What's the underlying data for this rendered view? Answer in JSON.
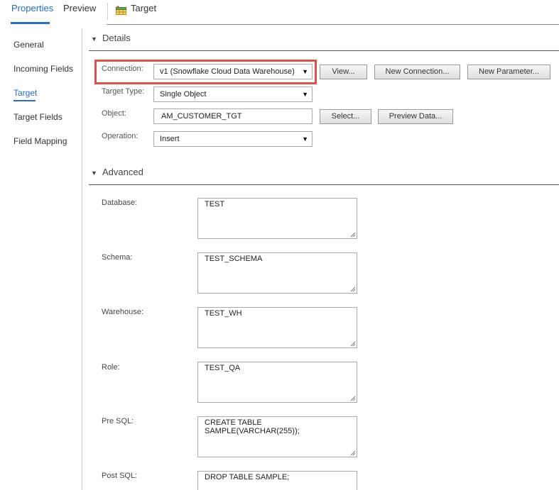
{
  "tabs": [
    {
      "label": "Properties",
      "active": true
    },
    {
      "label": "Preview",
      "active": false
    },
    {
      "label": "Target",
      "active": false,
      "icon": "target-table-icon"
    }
  ],
  "nav": [
    {
      "label": "General",
      "active": false
    },
    {
      "label": "Incoming Fields",
      "active": false
    },
    {
      "label": "Target",
      "active": true
    },
    {
      "label": "Target Fields",
      "active": false
    },
    {
      "label": "Field Mapping",
      "active": false
    }
  ],
  "details": {
    "title": "Details",
    "connection_label": "Connection:",
    "connection_value": "v1 (Snowflake Cloud Data Warehouse)",
    "view_button": "View...",
    "new_connection_button": "New Connection...",
    "new_parameter_button": "New Parameter...",
    "target_type_label": "Target Type:",
    "target_type_value": "Single Object",
    "object_label": "Object:",
    "object_value": "AM_CUSTOMER_TGT",
    "select_button": "Select...",
    "preview_button": "Preview Data...",
    "operation_label": "Operation:",
    "operation_value": "Insert"
  },
  "advanced": {
    "title": "Advanced",
    "fields": [
      {
        "label": "Database:",
        "value": "TEST"
      },
      {
        "label": "Schema:",
        "value": "TEST_SCHEMA"
      },
      {
        "label": "Warehouse:",
        "value": "TEST_WH"
      },
      {
        "label": "Role:",
        "value": "TEST_QA"
      },
      {
        "label": "Pre SQL:",
        "value": "CREATE TABLE SAMPLE(VARCHAR(255));"
      },
      {
        "label": "Post SQL:",
        "value": "DROP TABLE SAMPLE;"
      }
    ]
  },
  "colors": {
    "accent": "#2a6ebb",
    "highlight": "#d9534f"
  }
}
